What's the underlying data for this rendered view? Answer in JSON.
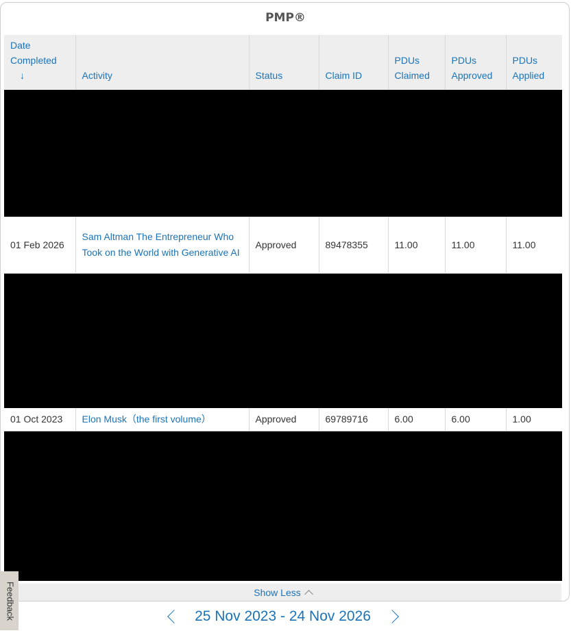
{
  "card": {
    "title": "PMP®"
  },
  "table": {
    "headers": {
      "date_completed_line1": "Date",
      "date_completed_line2": "Completed",
      "sort_arrow": "↓",
      "activity": "Activity",
      "status": "Status",
      "claim_id": "Claim ID",
      "pdus_claimed_line1": "PDUs",
      "pdus_claimed_line2": "Claimed",
      "pdus_approved_line1": "PDUs",
      "pdus_approved_line2": "Approved",
      "pdus_applied_line1": "PDUs",
      "pdus_applied_line2": "Applied"
    },
    "rows": [
      {
        "date": "01 Feb 2026",
        "activity": "Sam Altman The Entrepreneur Who Took on the World with Generative AI",
        "status": "Approved",
        "claim_id": "89478355",
        "pdus_claimed": "11.00",
        "pdus_approved": "11.00",
        "pdus_applied": "11.00"
      },
      {
        "date": "01 Oct 2023",
        "activity": "Elon Musk（the first volume）",
        "status": "Approved",
        "claim_id": "69789716",
        "pdus_claimed": "6.00",
        "pdus_approved": "6.00",
        "pdus_applied": "1.00"
      }
    ]
  },
  "show_less_label": "Show Less",
  "feedback_label": "Feedback",
  "date_range": "25 Nov 2023 - 24 Nov 2026",
  "colors": {
    "link": "#1a73b8",
    "header_bg": "#eeeeee",
    "redaction": "#000000"
  }
}
